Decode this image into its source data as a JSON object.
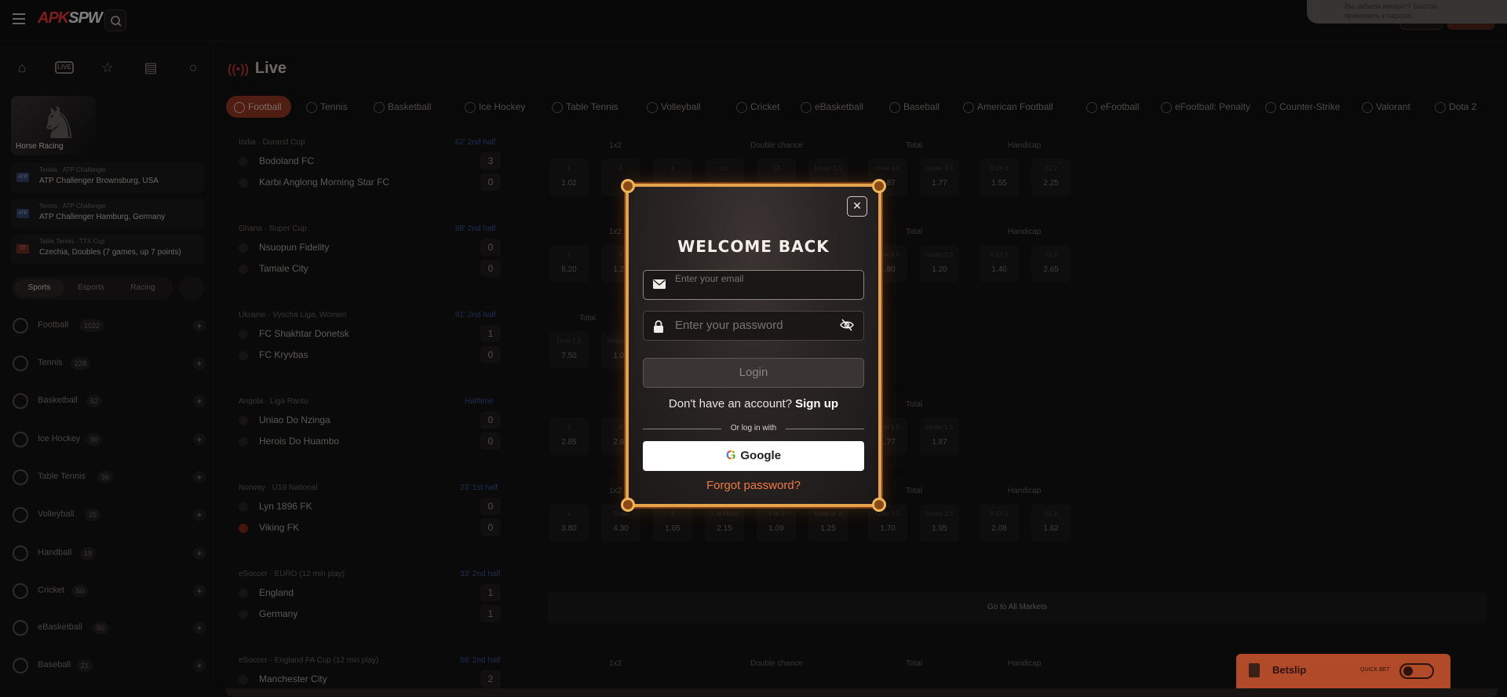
{
  "brand": {
    "logo_a": "APK",
    "logo_b": "SPW"
  },
  "toast": {
    "line1": "Вы забыли аккаунт? Быстро",
    "line2": "применить к паролю"
  },
  "sidebar": {
    "horse_label": "Horse Racing",
    "events": [
      {
        "cat": "Tennis · ATP Challenger",
        "name": "ATP Challenger Brownsburg, USA"
      },
      {
        "cat": "Tennis · ATP Challenger",
        "name": "ATP Challenger Hamburg, Germany"
      },
      {
        "cat": "Table Tennis · TTX Cup",
        "name": "Czechia, Doubles (7 games, up 7 points)"
      }
    ],
    "segments": [
      "Sports",
      "Esports",
      "Racing"
    ],
    "sports": [
      {
        "name": "Football",
        "count": "1022"
      },
      {
        "name": "Tennis",
        "count": "228"
      },
      {
        "name": "Basketball",
        "count": "62"
      },
      {
        "name": "Ice Hockey",
        "count": "90"
      },
      {
        "name": "Table Tennis",
        "count": "56"
      },
      {
        "name": "Volleyball",
        "count": "25"
      },
      {
        "name": "Handball",
        "count": "19"
      },
      {
        "name": "Cricket",
        "count": "50"
      },
      {
        "name": "eBasketball",
        "count": "50"
      },
      {
        "name": "Baseball",
        "count": "21"
      }
    ]
  },
  "main": {
    "live_title": "Live",
    "tabs": [
      "Football",
      "Tennis",
      "Basketball",
      "Ice Hockey",
      "Table Tennis",
      "Volleyball",
      "Cricket",
      "eBasketball",
      "Baseball",
      "American Football",
      "eFootball",
      "eFootball: Penalty",
      "Counter-Strike",
      "Valorant",
      "Dota 2"
    ],
    "markets": {
      "m1": "1x2",
      "m2": "Double chance",
      "m3": "Total",
      "m4": "Handicap"
    },
    "goto_all": "Go to All Markets",
    "matches": [
      {
        "league": "India · Durand Cup",
        "time": "62' 2nd half",
        "home": "Bodoland FC",
        "away": "Karbi Anglong Morning Star FC",
        "hs": "3",
        "as": "0"
      },
      {
        "league": "Ghana · Super Cup",
        "time": "88' 2nd half",
        "home": "Nsuopun Fidelity",
        "away": "Tamale City",
        "hs": "0",
        "as": "0"
      },
      {
        "league": "Ukraine · Vyscha Liga, Women",
        "time": "91' 2nd half",
        "home": "FC Shakhtar Donetsk",
        "away": "FC Kryvbas",
        "hs": "1",
        "as": "0"
      },
      {
        "league": "Angola · Liga Rantu",
        "time": "Halftime",
        "home": "Uniao Do Nzinga",
        "away": "Herois Do Huambo",
        "hs": "0",
        "as": "0"
      },
      {
        "league": "Norway · U19 National",
        "time": "23' 1st half",
        "home": "Lyn 1896 FK",
        "away": "Viking FK",
        "hs": "0",
        "as": "0"
      },
      {
        "league": "eSoccer · EURO (12 min play)",
        "time": "33' 2nd half",
        "home": "England",
        "away": "Germany",
        "hs": "1",
        "as": "1"
      },
      {
        "league": "eSoccer · England FA Cup (12 min play)",
        "time": "58' 2nd half",
        "home": "Manchester City",
        "away": "",
        "hs": "2",
        "as": ""
      }
    ],
    "odds": {
      "r1": [
        "1.02",
        "1.87",
        "1.77",
        "1.55",
        "2.25"
      ],
      "r2": [
        "6.20",
        "1.20",
        "1.80",
        "1.20",
        "1.40",
        "2.65"
      ],
      "r3": [
        "7.50",
        "1.04"
      ],
      "r4": [
        "2.85",
        "2.65",
        "1.77",
        "1.87"
      ],
      "r5": [
        "3.80",
        "4.30",
        "1.65",
        "2.15",
        "1.09",
        "1.25",
        "1.70",
        "1.95",
        "2.08",
        "1.62"
      ]
    }
  },
  "betslip": {
    "title": "Betslip",
    "quick": "QUICK BET"
  },
  "modal": {
    "title": "WELCOME BACK",
    "email_placeholder": "Enter your email",
    "password_placeholder": "Enter your password",
    "login": "Login",
    "no_account": "Don't have an account?",
    "signup": "Sign up",
    "or": "Or log in with",
    "google": "Google",
    "forgot": "Forgot password?"
  }
}
